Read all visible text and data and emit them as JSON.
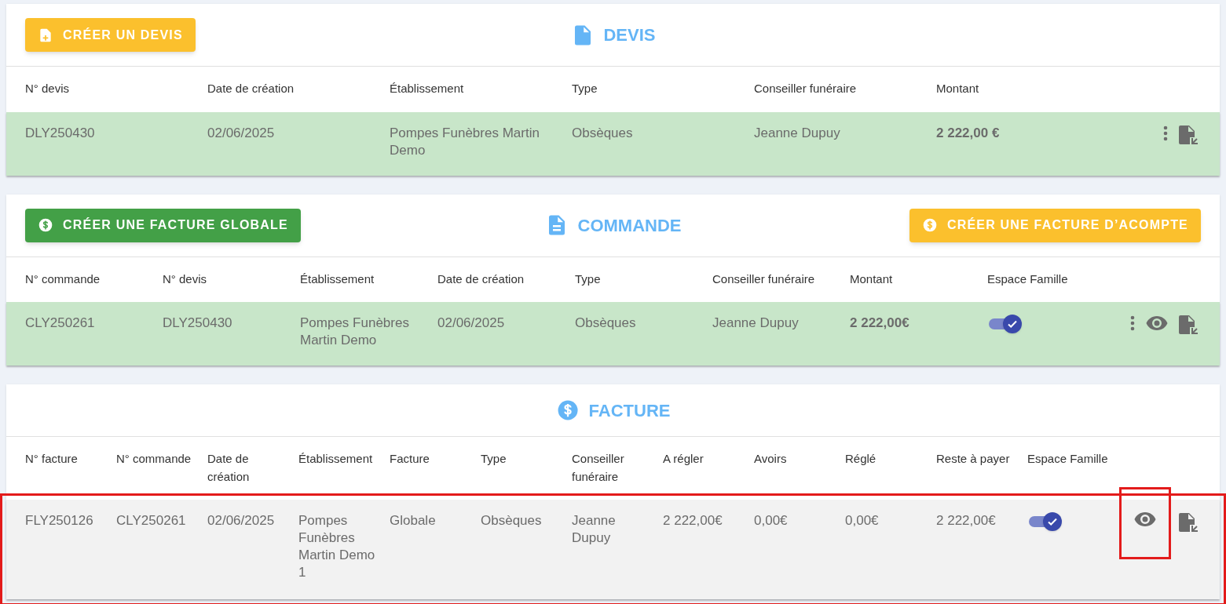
{
  "sections": [
    {
      "title": "DEVIS",
      "left_button": {
        "label": "CRÉER UN DEVIS",
        "color": "#fbc02d"
      },
      "columns": [
        "N° devis",
        "Date de création",
        "Établissement",
        "Type",
        "Conseiller funéraire",
        "Montant"
      ],
      "rows": [
        {
          "highlighted": false,
          "cells": [
            {
              "kind": "text",
              "text": "DLY250430",
              "bold": false
            },
            {
              "kind": "text",
              "text": "02/06/2025",
              "bold": false
            },
            {
              "kind": "text",
              "text": "Pompes Funèbres Martin Demo",
              "bold": false
            },
            {
              "kind": "text",
              "text": "Obsèques",
              "bold": false
            },
            {
              "kind": "text",
              "text": "Jeanne Dupuy",
              "bold": false
            },
            {
              "kind": "text",
              "text": "2 222,00 €",
              "bold": true
            }
          ],
          "actions": [
            {
              "kind": "more",
              "highlighted": false
            },
            {
              "kind": "export",
              "highlighted": false
            }
          ]
        }
      ]
    },
    {
      "title": "COMMANDE",
      "left_button": {
        "label": "CRÉER UNE FACTURE GLOBALE",
        "color": "#43a047"
      },
      "right_button": {
        "label": "CRÉER UNE FACTURE D’ACOMPTE",
        "color": "#fbc02d"
      },
      "columns": [
        "N° commande",
        "N° devis",
        "Établissement",
        "Date de création",
        "Type",
        "Conseiller funéraire",
        "Montant",
        "Espace Famille"
      ],
      "rows": [
        {
          "highlighted": false,
          "cells": [
            {
              "kind": "text",
              "text": "CLY250261",
              "bold": false
            },
            {
              "kind": "text",
              "text": "DLY250430",
              "bold": false
            },
            {
              "kind": "text",
              "text": "Pompes Funèbres Martin Demo",
              "bold": false
            },
            {
              "kind": "text",
              "text": "02/06/2025",
              "bold": false
            },
            {
              "kind": "text",
              "text": "Obsèques",
              "bold": false
            },
            {
              "kind": "text",
              "text": "Jeanne Dupuy",
              "bold": false
            },
            {
              "kind": "text",
              "text": "2 222,00€",
              "bold": true
            },
            {
              "kind": "toggle",
              "on": true
            }
          ],
          "actions": [
            {
              "kind": "more",
              "highlighted": false
            },
            {
              "kind": "view",
              "highlighted": false
            },
            {
              "kind": "export",
              "highlighted": false
            }
          ]
        }
      ]
    },
    {
      "title": "FACTURE",
      "columns": [
        "N° facture",
        "N° commande",
        "Date de création",
        "Établissement",
        "Facture",
        "Type",
        "Conseiller funéraire",
        "A régler",
        "Avoirs",
        "Réglé",
        "Reste à payer",
        "Espace Famille"
      ],
      "rows": [
        {
          "highlighted": true,
          "cells": [
            {
              "kind": "text",
              "text": "FLY250126",
              "bold": false
            },
            {
              "kind": "text",
              "text": "CLY250261",
              "bold": false
            },
            {
              "kind": "text",
              "text": "02/06/2025",
              "bold": false
            },
            {
              "kind": "text",
              "text": "Pompes Funèbres Martin Demo 1",
              "bold": false
            },
            {
              "kind": "text",
              "text": "Globale",
              "bold": false
            },
            {
              "kind": "text",
              "text": "Obsèques",
              "bold": false
            },
            {
              "kind": "text",
              "text": "Jeanne Dupuy",
              "bold": false
            },
            {
              "kind": "text",
              "text": "2 222,00€",
              "bold": false
            },
            {
              "kind": "text",
              "text": "0,00€",
              "bold": false
            },
            {
              "kind": "text",
              "text": "0,00€",
              "bold": false
            },
            {
              "kind": "text",
              "text": "2 222,00€",
              "bold": false
            },
            {
              "kind": "toggle",
              "on": true
            }
          ],
          "actions": [
            {
              "kind": "view",
              "highlighted": true
            },
            {
              "kind": "export",
              "highlighted": false
            }
          ]
        }
      ]
    }
  ]
}
